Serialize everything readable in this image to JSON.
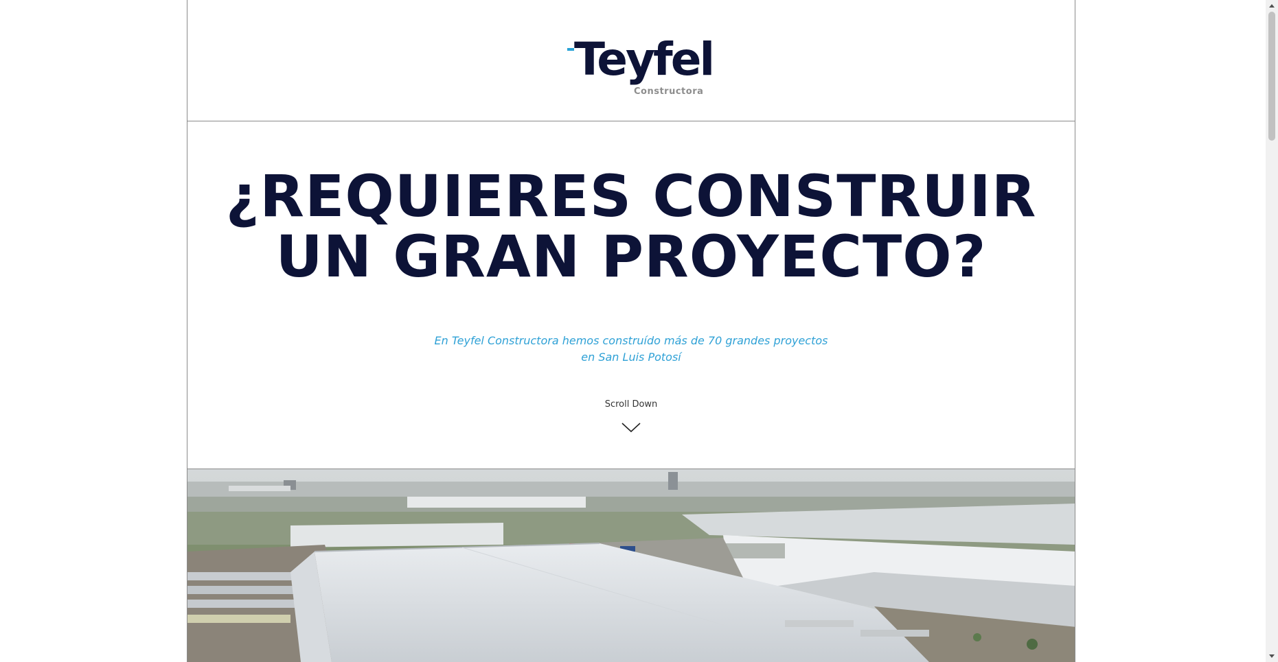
{
  "brand": {
    "name": "Teyfel",
    "tagline": "Constructora",
    "accent_color": "#29a3d6",
    "primary_color": "#0d1337"
  },
  "hero": {
    "title_line1": "¿REQUIERES CONSTRUIR",
    "title_line2": "UN GRAN PROYECTO?",
    "subtitle_line1": "En Teyfel Constructora hemos construído más de 70 grandes proyectos",
    "subtitle_line2": "en San Luis Potosí"
  },
  "scroll": {
    "label": "Scroll Down",
    "icon": "chevron-down-icon"
  },
  "image": {
    "icon": "aerial-industrial-park-photo"
  }
}
